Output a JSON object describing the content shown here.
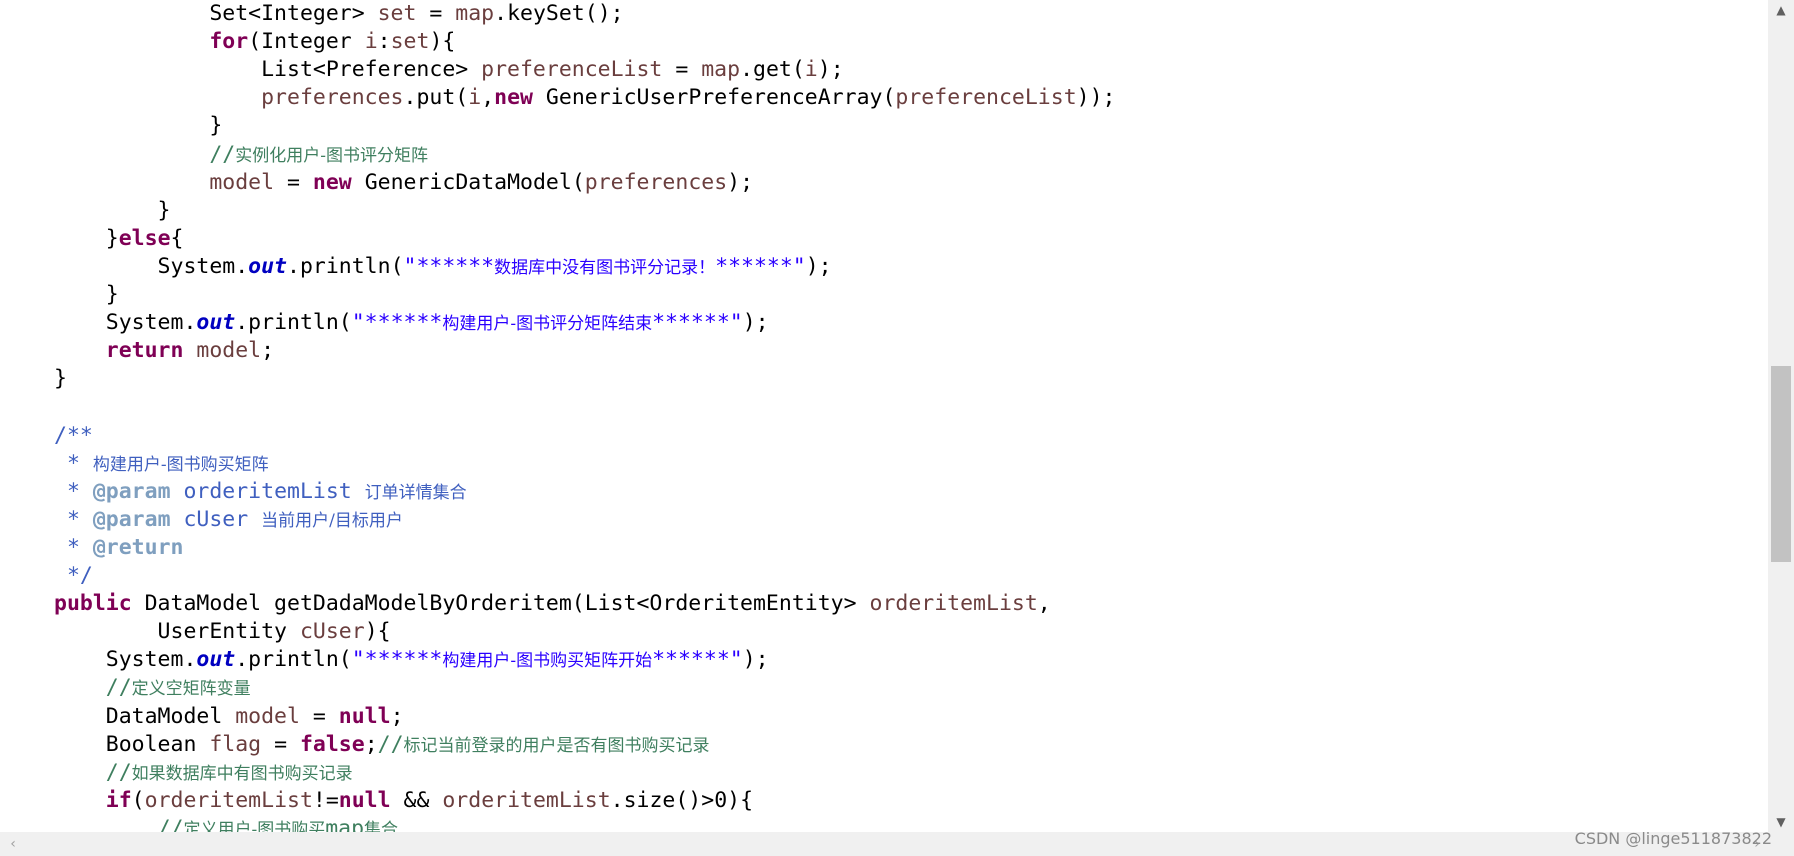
{
  "editor": {
    "lines": [
      [
        [
          "plain",
          "            Set<Integer> "
        ],
        [
          "var",
          "set"
        ],
        [
          "plain",
          " = "
        ],
        [
          "var",
          "map"
        ],
        [
          "plain",
          ".keySet();"
        ]
      ],
      [
        [
          "plain",
          "            "
        ],
        [
          "kw",
          "for"
        ],
        [
          "plain",
          "(Integer "
        ],
        [
          "var",
          "i"
        ],
        [
          "plain",
          ":"
        ],
        [
          "var",
          "set"
        ],
        [
          "plain",
          "){"
        ]
      ],
      [
        [
          "plain",
          "                List<Preference> "
        ],
        [
          "var",
          "preferenceList"
        ],
        [
          "plain",
          " = "
        ],
        [
          "var",
          "map"
        ],
        [
          "plain",
          ".get("
        ],
        [
          "var",
          "i"
        ],
        [
          "plain",
          ");"
        ]
      ],
      [
        [
          "plain",
          "                "
        ],
        [
          "var",
          "preferences"
        ],
        [
          "plain",
          ".put("
        ],
        [
          "var",
          "i"
        ],
        [
          "plain",
          ","
        ],
        [
          "kw",
          "new"
        ],
        [
          "plain",
          " GenericUserPreferenceArray("
        ],
        [
          "var",
          "preferenceList"
        ],
        [
          "plain",
          "));"
        ]
      ],
      [
        [
          "plain",
          "            }"
        ]
      ],
      [
        [
          "plain",
          "            "
        ],
        [
          "cmt",
          "//"
        ],
        [
          "cmtcjk",
          "实例化用户-图书评分矩阵"
        ]
      ],
      [
        [
          "plain",
          "            "
        ],
        [
          "var",
          "model"
        ],
        [
          "plain",
          " = "
        ],
        [
          "kw",
          "new"
        ],
        [
          "plain",
          " GenericDataModel("
        ],
        [
          "var",
          "preferences"
        ],
        [
          "plain",
          ");"
        ]
      ],
      [
        [
          "plain",
          "        }"
        ]
      ],
      [
        [
          "plain",
          "    }"
        ],
        [
          "kw",
          "else"
        ],
        [
          "plain",
          "{"
        ]
      ],
      [
        [
          "plain",
          "        System."
        ],
        [
          "static",
          "out"
        ],
        [
          "plain",
          ".println("
        ],
        [
          "str",
          "\"******"
        ],
        [
          "strcjk",
          "数据库中没有图书评分记录！"
        ],
        [
          "str",
          "******\""
        ],
        [
          "plain",
          ");"
        ]
      ],
      [
        [
          "plain",
          "    }"
        ]
      ],
      [
        [
          "plain",
          "    System."
        ],
        [
          "static",
          "out"
        ],
        [
          "plain",
          ".println("
        ],
        [
          "str",
          "\"******"
        ],
        [
          "strcjk",
          "构建用户-图书评分矩阵结束"
        ],
        [
          "str",
          "******\""
        ],
        [
          "plain",
          ");"
        ]
      ],
      [
        [
          "plain",
          "    "
        ],
        [
          "kw",
          "return"
        ],
        [
          "plain",
          " "
        ],
        [
          "var",
          "model"
        ],
        [
          "plain",
          ";"
        ]
      ],
      [
        [
          "plain",
          "}"
        ]
      ],
      [],
      [
        [
          "doc",
          "/**"
        ]
      ],
      [
        [
          "doc",
          " * "
        ],
        [
          "doccjk",
          "构建用户-图书购买矩阵"
        ]
      ],
      [
        [
          "doc",
          " * "
        ],
        [
          "tag",
          "@param"
        ],
        [
          "doc",
          " orderitemList "
        ],
        [
          "doccjk",
          "订单详情集合"
        ]
      ],
      [
        [
          "doc",
          " * "
        ],
        [
          "tag",
          "@param"
        ],
        [
          "doc",
          " cUser "
        ],
        [
          "doccjk",
          "当前用户/目标用户"
        ]
      ],
      [
        [
          "doc",
          " * "
        ],
        [
          "tag",
          "@return"
        ]
      ],
      [
        [
          "doc",
          " */"
        ]
      ],
      [
        [
          "kw",
          "public"
        ],
        [
          "plain",
          " DataModel getDadaModelByOrderitem(List<OrderitemEntity> "
        ],
        [
          "var",
          "orderitemList"
        ],
        [
          "plain",
          ","
        ]
      ],
      [
        [
          "plain",
          "        UserEntity "
        ],
        [
          "var",
          "cUser"
        ],
        [
          "plain",
          "){"
        ]
      ],
      [
        [
          "plain",
          "    System."
        ],
        [
          "static",
          "out"
        ],
        [
          "plain",
          ".println("
        ],
        [
          "str",
          "\"******"
        ],
        [
          "strcjk",
          "构建用户-图书购买矩阵开始"
        ],
        [
          "str",
          "******\""
        ],
        [
          "plain",
          ");"
        ]
      ],
      [
        [
          "plain",
          "    "
        ],
        [
          "cmt",
          "//"
        ],
        [
          "cmtcjk",
          "定义空矩阵变量"
        ]
      ],
      [
        [
          "plain",
          "    DataModel "
        ],
        [
          "var",
          "model"
        ],
        [
          "plain",
          " = "
        ],
        [
          "kw",
          "null"
        ],
        [
          "plain",
          ";"
        ]
      ],
      [
        [
          "plain",
          "    Boolean "
        ],
        [
          "var",
          "flag"
        ],
        [
          "plain",
          " = "
        ],
        [
          "kw",
          "false"
        ],
        [
          "plain",
          ";"
        ],
        [
          "cmt",
          "//"
        ],
        [
          "cmtcjk",
          "标记当前登录的用户是否有图书购买记录"
        ]
      ],
      [
        [
          "plain",
          "    "
        ],
        [
          "cmt",
          "//"
        ],
        [
          "cmtcjk",
          "如果数据库中有图书购买记录"
        ]
      ],
      [
        [
          "plain",
          "    "
        ],
        [
          "kw",
          "if"
        ],
        [
          "plain",
          "("
        ],
        [
          "var",
          "orderitemList"
        ],
        [
          "plain",
          "!="
        ],
        [
          "kw",
          "null"
        ],
        [
          "plain",
          " && "
        ],
        [
          "var",
          "orderitemList"
        ],
        [
          "plain",
          ".size()>0){"
        ]
      ],
      [
        [
          "plain",
          "        "
        ],
        [
          "cmt",
          "//"
        ],
        [
          "cmtcjk",
          "定义用户-图书购买"
        ],
        [
          "cmt",
          "map"
        ],
        [
          "cmtcjk",
          "集合"
        ]
      ]
    ]
  },
  "icons": {
    "scroll_up": "▲",
    "scroll_down": "▼",
    "scroll_left": "‹",
    "scroll_right": "›"
  },
  "watermark": "CSDN @linge511873822",
  "colors": {
    "keyword": "#7f0055",
    "local_variable": "#6a3e3e",
    "static_field": "#0000c0",
    "string": "#2a00ff",
    "comment": "#3f7f5f",
    "javadoc": "#3f5fbf",
    "javadoc_tag": "#7f9fbf"
  }
}
